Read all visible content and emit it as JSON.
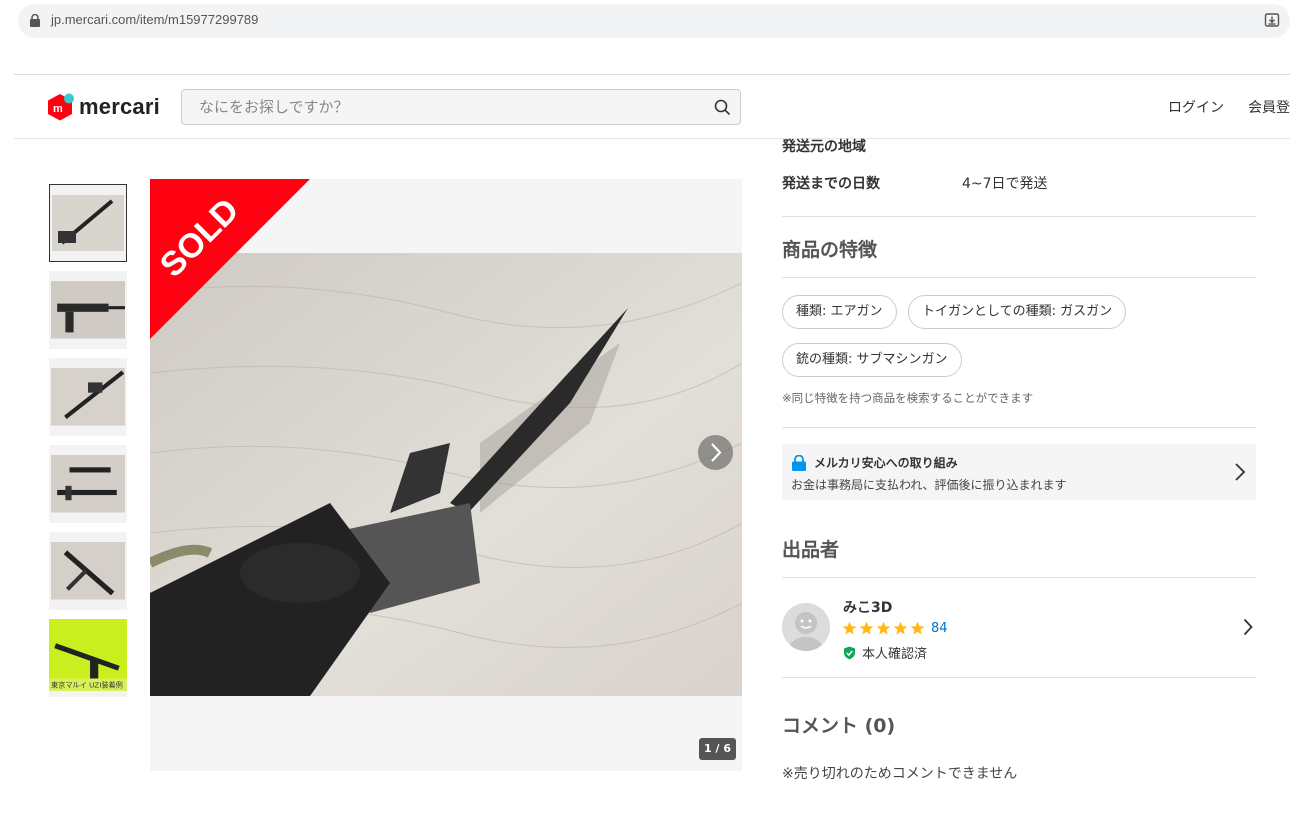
{
  "browser": {
    "url": "jp.mercari.com/item/m15977299789"
  },
  "header": {
    "logo_text": "mercari",
    "search_placeholder": "なにをお探しですか？",
    "login": "ログイン",
    "register": "会員登"
  },
  "colors": {
    "brand_red": "#ff0211",
    "link_blue": "#0073cc",
    "star_orange": "#ffb818",
    "verified_green": "#15a45b"
  },
  "gallery": {
    "sold_label": "SOLD",
    "counter": "1 / 6",
    "thumb_caption_6": "東京マルイ UZI装着例"
  },
  "details": {
    "ship_from_label": "発送元の地域",
    "ship_days_label": "発送までの日数",
    "ship_days_value": "4~7日で発送"
  },
  "features": {
    "title": "商品の特徴",
    "chips": [
      "種類: エアガン",
      "トイガンとしての種類: ガスガン",
      "銃の種類: サブマシンガン"
    ],
    "note": "※同じ特徴を持つ商品を検索することができます"
  },
  "anshin": {
    "title": "メルカリ安心への取り組み",
    "desc": "お金は事務局に支払われ、評価後に振り込まれます"
  },
  "seller": {
    "title": "出品者",
    "name": "みこ3D",
    "rating_stars": 5,
    "review_count": "84",
    "verified": "本人確認済"
  },
  "comments": {
    "title": "コメント (0)",
    "note": "※売り切れのためコメントできません"
  }
}
